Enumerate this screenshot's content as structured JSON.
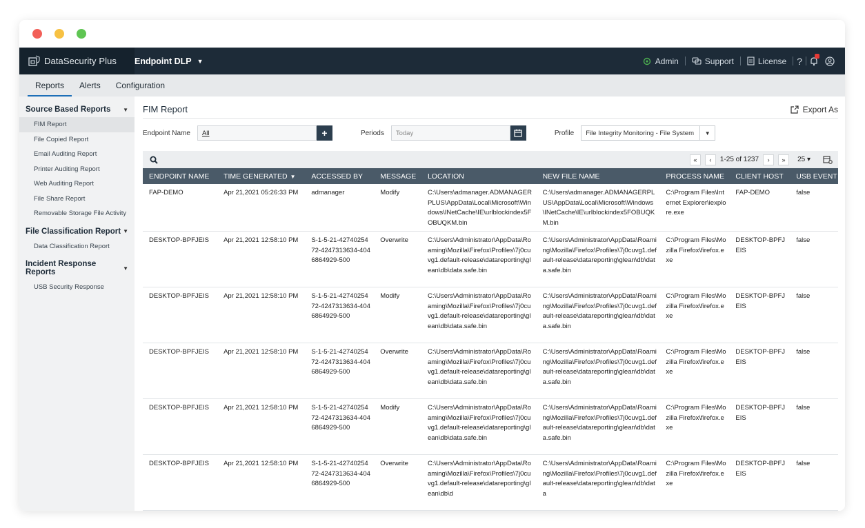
{
  "app": {
    "brand": "DataSecurity Plus",
    "product": "Endpoint DLP",
    "right_nav": {
      "admin": "Admin",
      "support": "Support",
      "license": "License"
    }
  },
  "tabs": [
    {
      "label": "Reports"
    },
    {
      "label": "Alerts"
    },
    {
      "label": "Configuration"
    }
  ],
  "sidebar": {
    "groups": [
      {
        "label": "Source Based Reports",
        "items": [
          "FIM Report",
          "File Copied Report",
          "Email Auditing Report",
          "Printer Auditing Report",
          "Web Auditing Report",
          "File Share Report",
          "Removable Storage File Activity"
        ]
      },
      {
        "label": "File Classification Report",
        "items": [
          "Data Classification Report"
        ]
      },
      {
        "label": "Incident Response Reports",
        "items": [
          "USB Security Response"
        ]
      }
    ]
  },
  "report": {
    "title": "FIM Report",
    "export_label": "Export As",
    "filters": {
      "endpoint_label": "Endpoint Name",
      "endpoint_value": "All",
      "periods_label": "Periods",
      "periods_placeholder": "Today",
      "profile_label": "Profile",
      "profile_value": "File Integrity Monitoring - File System"
    },
    "pager": {
      "range": "1-25 of 1237",
      "page_size": "25"
    },
    "columns": [
      "ENDPOINT NAME",
      "TIME GENERATED",
      "ACCESSED BY",
      "MESSAGE",
      "LOCATION",
      "NEW FILE NAME",
      "PROCESS NAME",
      "CLIENT HOST",
      "USB EVENT"
    ],
    "rows": [
      [
        "FAP-DEMO",
        "Apr 21,2021 05:26:33 PM",
        "admanager",
        "Modify",
        "C:\\Users\\admanager.ADMANAGERPLUS\\AppData\\Local\\Microsoft\\Windows\\INetCache\\IE\\urlblockindex5FOBUQKM.bin",
        "C:\\Users\\admanager.ADMANAGERPLUS\\AppData\\Local\\Microsoft\\Windows\\INetCache\\IE\\urlblockindex5FOBUQKM.bin",
        "C:\\Program Files\\Internet Explorer\\iexplore.exe",
        "FAP-DEMO",
        "false"
      ],
      [
        "DESKTOP-BPFJEIS",
        "Apr 21,2021 12:58:10 PM",
        "S-1-5-21-4274025472-4247313634-4046864929-500",
        "Overwrite",
        "C:\\Users\\Administrator\\AppData\\Roaming\\Mozilla\\Firefox\\Profiles\\7j0cuvg1.default-release\\datareporting\\glean\\db\\data.safe.bin",
        "C:\\Users\\Administrator\\AppData\\Roaming\\Mozilla\\Firefox\\Profiles\\7j0cuvg1.default-release\\datareporting\\glean\\db\\data.safe.bin",
        "C:\\Program Files\\Mozilla Firefox\\firefox.exe",
        "DESKTOP-BPFJEIS",
        "false"
      ],
      [
        "DESKTOP-BPFJEIS",
        "Apr 21,2021 12:58:10 PM",
        "S-1-5-21-4274025472-4247313634-4046864929-500",
        "Modify",
        "C:\\Users\\Administrator\\AppData\\Roaming\\Mozilla\\Firefox\\Profiles\\7j0cuvg1.default-release\\datareporting\\glean\\db\\data.safe.bin",
        "C:\\Users\\Administrator\\AppData\\Roaming\\Mozilla\\Firefox\\Profiles\\7j0cuvg1.default-release\\datareporting\\glean\\db\\data.safe.bin",
        "C:\\Program Files\\Mozilla Firefox\\firefox.exe",
        "DESKTOP-BPFJEIS",
        "false"
      ],
      [
        "DESKTOP-BPFJEIS",
        "Apr 21,2021 12:58:10 PM",
        "S-1-5-21-4274025472-4247313634-4046864929-500",
        "Overwrite",
        "C:\\Users\\Administrator\\AppData\\Roaming\\Mozilla\\Firefox\\Profiles\\7j0cuvg1.default-release\\datareporting\\glean\\db\\data.safe.bin",
        "C:\\Users\\Administrator\\AppData\\Roaming\\Mozilla\\Firefox\\Profiles\\7j0cuvg1.default-release\\datareporting\\glean\\db\\data.safe.bin",
        "C:\\Program Files\\Mozilla Firefox\\firefox.exe",
        "DESKTOP-BPFJEIS",
        "false"
      ],
      [
        "DESKTOP-BPFJEIS",
        "Apr 21,2021 12:58:10 PM",
        "S-1-5-21-4274025472-4247313634-4046864929-500",
        "Modify",
        "C:\\Users\\Administrator\\AppData\\Roaming\\Mozilla\\Firefox\\Profiles\\7j0cuvg1.default-release\\datareporting\\glean\\db\\data.safe.bin",
        "C:\\Users\\Administrator\\AppData\\Roaming\\Mozilla\\Firefox\\Profiles\\7j0cuvg1.default-release\\datareporting\\glean\\db\\data.safe.bin",
        "C:\\Program Files\\Mozilla Firefox\\firefox.exe",
        "DESKTOP-BPFJEIS",
        "false"
      ],
      [
        "DESKTOP-BPFJEIS",
        "Apr 21,2021 12:58:10 PM",
        "S-1-5-21-4274025472-4247313634-4046864929-500",
        "Overwrite",
        "C:\\Users\\Administrator\\AppData\\Roaming\\Mozilla\\Firefox\\Profiles\\7j0cuvg1.default-release\\datareporting\\glean\\db\\d",
        "C:\\Users\\Administrator\\AppData\\Roaming\\Mozilla\\Firefox\\Profiles\\7j0cuvg1.default-release\\datareporting\\glean\\db\\data",
        "C:\\Program Files\\Mozilla Firefox\\firefox.exe",
        "DESKTOP-BPFJEIS",
        "false"
      ]
    ]
  },
  "colors": {
    "nav_bg": "#1d2b38",
    "header_bg": "#4a5a68",
    "accent": "#1d6fb8"
  }
}
